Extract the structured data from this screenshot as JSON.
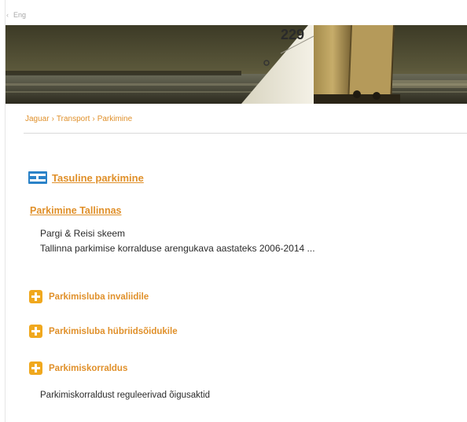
{
  "topbar": {
    "back_icon": "chevron-left-icon",
    "text": "Eng"
  },
  "banner": {
    "sail_number": "229",
    "icon": "sailing-photo"
  },
  "breadcrumb": {
    "items": [
      "Jaguar",
      "Transport",
      "Parkimine"
    ],
    "separator": "›"
  },
  "section": {
    "title": "Tasuline parkimine",
    "icon": "parking-sign-icon"
  },
  "subsection": {
    "title": "Parkimine Tallinnas"
  },
  "links": [
    "Pargi & Reisi skeem",
    "Tallinna parkimise korralduse arengukava aastateks 2006-2014 ..."
  ],
  "expandables": [
    {
      "label": "Parkimisluba invaliidile",
      "icon": "plus-icon"
    },
    {
      "label": "Parkimisluba hübriidsõidukile",
      "icon": "plus-icon"
    },
    {
      "label": "Parkimiskorraldus",
      "icon": "plus-icon"
    }
  ],
  "note": "Parkimiskorraldust reguleerivad õigusaktid",
  "colors": {
    "accent": "#e0902a",
    "plus_bg": "#f0a81e",
    "icon_blue": "#2a82c8"
  }
}
